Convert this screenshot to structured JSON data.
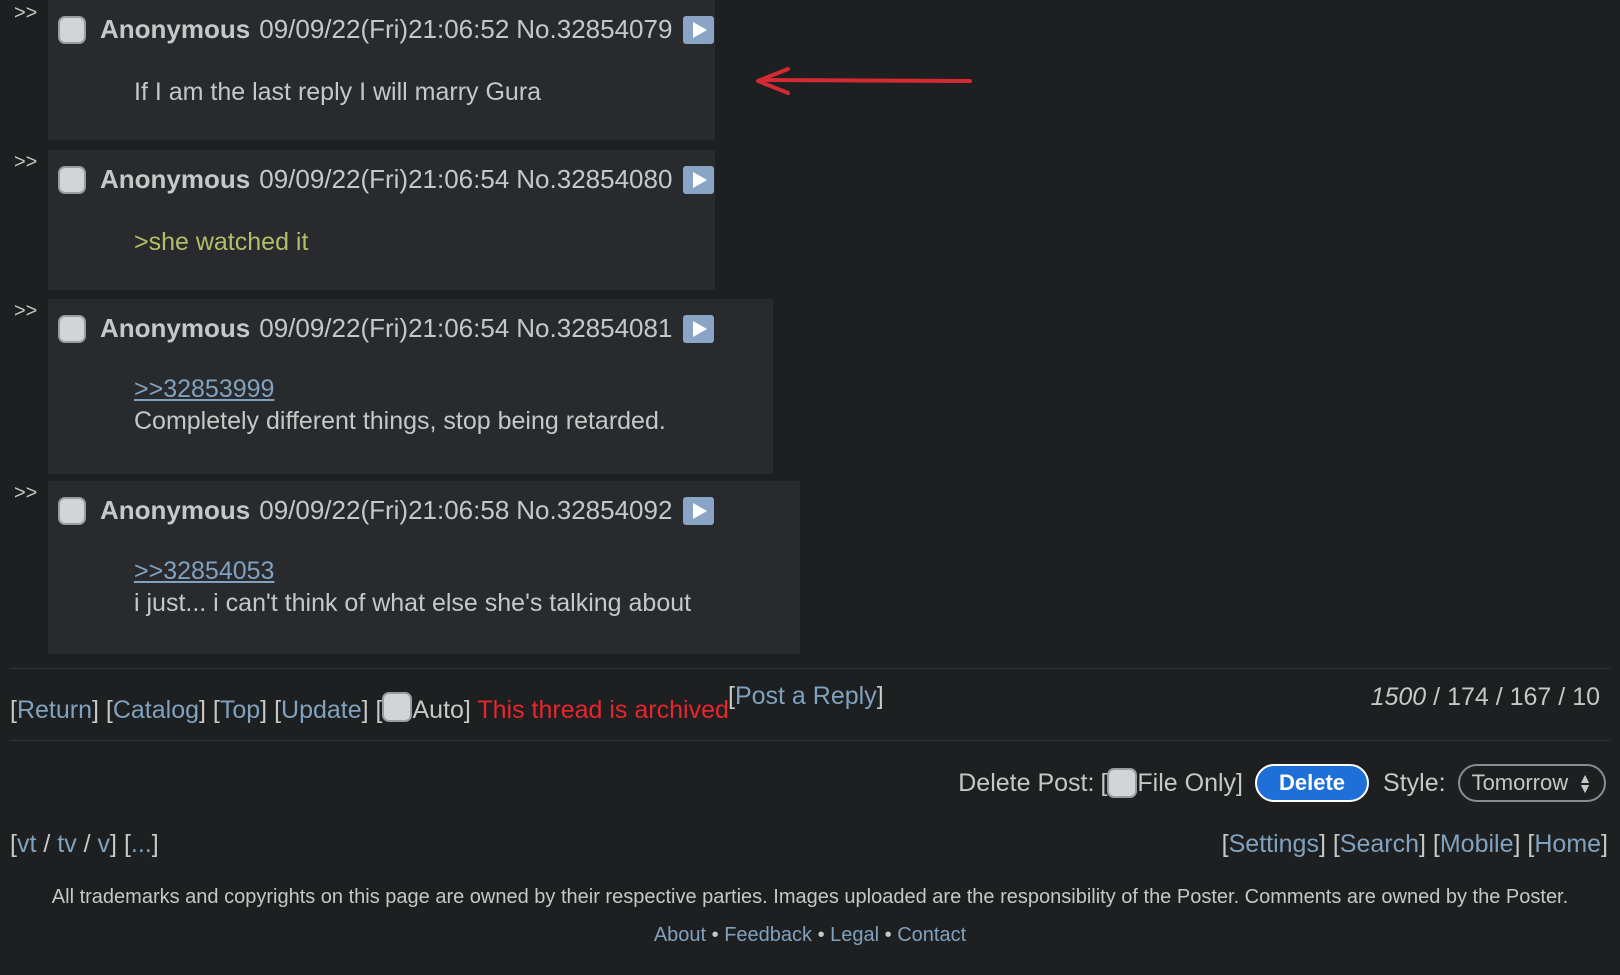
{
  "reply_marker": ">>",
  "posts": [
    {
      "name": "Anonymous",
      "datetime": "09/09/22(Fri)21:06:52",
      "number": "No.32854079",
      "quote": "",
      "text": "If I am the last reply I will marry Gura",
      "greentext": false
    },
    {
      "name": "Anonymous",
      "datetime": "09/09/22(Fri)21:06:54",
      "number": "No.32854080",
      "quote": "",
      "text": ">she watched it",
      "greentext": true
    },
    {
      "name": "Anonymous",
      "datetime": "09/09/22(Fri)21:06:54",
      "number": "No.32854081",
      "quote": ">>32853999",
      "text": "Completely different things, stop being retarded.",
      "greentext": false
    },
    {
      "name": "Anonymous",
      "datetime": "09/09/22(Fri)21:06:58",
      "number": "No.32854092",
      "quote": ">>32854053",
      "text": "i just... i can't think of what else she's talking about",
      "greentext": false
    }
  ],
  "nav": {
    "return": "Return",
    "catalog": "Catalog",
    "top": "Top",
    "update": "Update",
    "auto": "Auto",
    "archived": "This thread is archived",
    "post_reply": "Post a Reply"
  },
  "stats": {
    "replies": "1500",
    "images": "174",
    "posters": "167",
    "page": "10"
  },
  "delete": {
    "label": "Delete Post:",
    "file_only": "File Only",
    "button": "Delete"
  },
  "style": {
    "label": "Style:",
    "value": "Tomorrow"
  },
  "boards": {
    "items": [
      "vt",
      "tv",
      "v"
    ],
    "more": "..."
  },
  "links_right": [
    "Settings",
    "Search",
    "Mobile",
    "Home"
  ],
  "footer": {
    "disclaimer": "All trademarks and copyrights on this page are owned by their respective parties. Images uploaded are the responsibility of the Poster. Comments are owned by the Poster.",
    "links": [
      "About",
      "Feedback",
      "Legal",
      "Contact"
    ]
  },
  "annotation": {
    "shape": "red-arrow-left",
    "color": "#d42a34"
  },
  "colors": {
    "background": "#1d1f21",
    "post_bg": "#282a2e",
    "link": "#81a2be",
    "greentext": "#b5bd68",
    "archived": "#e8262b",
    "delete_btn": "#1f6fd8"
  }
}
